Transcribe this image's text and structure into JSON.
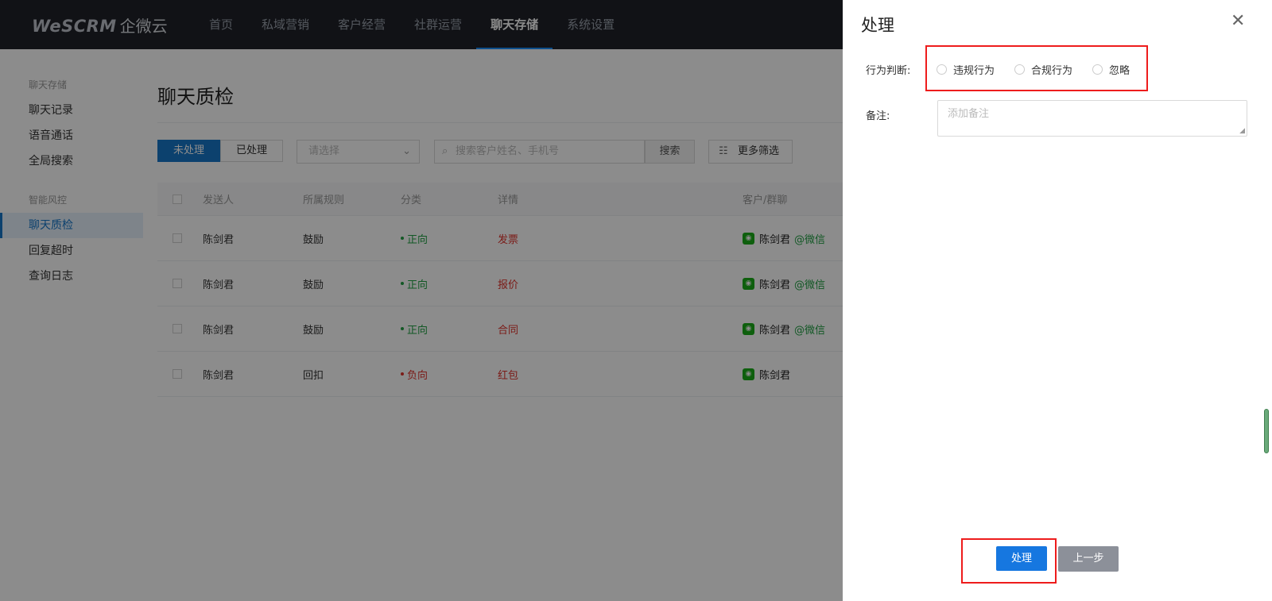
{
  "topnav": {
    "logo_brand": "WeSCRM",
    "logo_cn": "企微云",
    "items": [
      "首页",
      "私域营销",
      "客户经营",
      "社群运营",
      "聊天存储",
      "系统设置"
    ],
    "active_index": 4
  },
  "sidebar": {
    "group1": "聊天存储",
    "group1_items": [
      "聊天记录",
      "语音通话",
      "全局搜索"
    ],
    "group2": "智能风控",
    "group2_items": [
      "聊天质检",
      "回复超时",
      "查询日志"
    ],
    "active": "聊天质检"
  },
  "main": {
    "title": "聊天质检",
    "tabs": [
      "未处理",
      "已处理"
    ],
    "select_placeholder": "请选择",
    "search_placeholder": "搜索客户姓名、手机号",
    "search_button": "搜索",
    "more_filter": "更多筛选",
    "columns": [
      "发送人",
      "所属规则",
      "分类",
      "详情",
      "客户/群聊"
    ],
    "rows": [
      {
        "sender": "陈剑君",
        "rule": "鼓励",
        "category": "正向",
        "detail": "发票",
        "customer": "陈剑君",
        "suffix": "@微信"
      },
      {
        "sender": "陈剑君",
        "rule": "鼓励",
        "category": "正向",
        "detail": "报价",
        "customer": "陈剑君",
        "suffix": "@微信"
      },
      {
        "sender": "陈剑君",
        "rule": "鼓励",
        "category": "正向",
        "detail": "合同",
        "customer": "陈剑君",
        "suffix": "@微信"
      },
      {
        "sender": "陈剑君",
        "rule": "回扣",
        "category": "负向",
        "detail": "红包",
        "customer": "陈剑君",
        "suffix": ""
      }
    ]
  },
  "drawer": {
    "title": "处理",
    "judgement_label": "行为判断:",
    "options": [
      "违规行为",
      "合规行为",
      "忽略"
    ],
    "note_label": "备注:",
    "note_placeholder": "添加备注",
    "submit": "处理",
    "prev": "上一步"
  },
  "colors": {
    "accent": "#1677e0",
    "highlight": "#ee1c1c",
    "positive": "#22a044",
    "negative": "#e0332c"
  }
}
